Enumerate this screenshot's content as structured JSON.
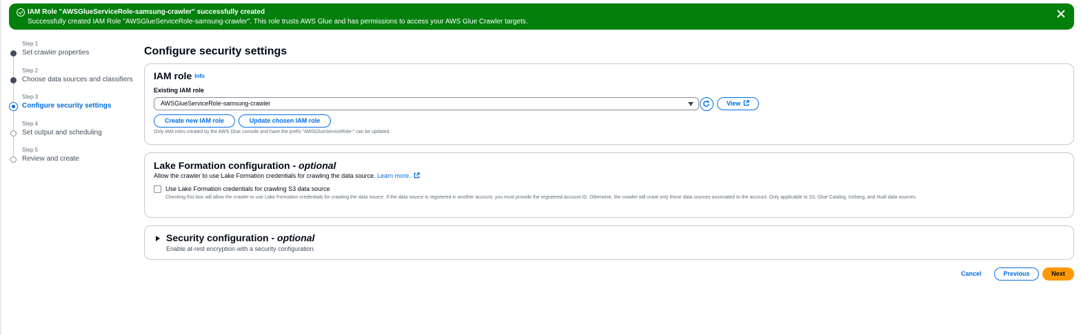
{
  "flash": {
    "title": "IAM Role \"AWSGlueServiceRole-samsung-crawler\" successfully created",
    "message": "Successfully created IAM Role \"AWSGlueServiceRole-samsung-crawler\". This role trusts AWS Glue and has permissions to access your AWS Glue Crawler targets.",
    "color": "#037f0c"
  },
  "steps": [
    {
      "num": "Step 1",
      "label": "Set crawler properties",
      "state": "done"
    },
    {
      "num": "Step 2",
      "label": "Choose data sources and classifiers",
      "state": "done"
    },
    {
      "num": "Step 3",
      "label": "Configure security settings",
      "state": "active"
    },
    {
      "num": "Step 4",
      "label": "Set output and scheduling",
      "state": "pending"
    },
    {
      "num": "Step 5",
      "label": "Review and create",
      "state": "pending"
    }
  ],
  "page_title": "Configure security settings",
  "iam": {
    "heading": "IAM role",
    "info": "Info",
    "field_label": "Existing IAM role",
    "selected": "AWSGlueServiceRole-samsung-crawler",
    "view_label": "View",
    "create_label": "Create new IAM role",
    "update_label": "Update chosen IAM role",
    "hint": "Only IAM roles created by the AWS Glue console and have the prefix \"AWSGlueServiceRole-\" can be updated."
  },
  "lake_formation": {
    "heading": "Lake Formation configuration - ",
    "heading_optional": "optional",
    "desc": "Allow the crawler to use Lake Formation credentials for crawling the data source. ",
    "learn_more": "Learn more.",
    "checkbox_label": "Use Lake Formation credentials for crawling S3 data source",
    "checkbox_desc": "Checking this box will allow the crawler to use Lake Formation credentials for crawling the data source. If the data source is registered in another account, you must provide the registered account ID. Otherwise, the crawler will crawl only those data sources associated to the account. Only applicable to S3, Glue Catalog, Iceberg, and Hudi data sources.",
    "checked": false
  },
  "security_config": {
    "heading": "Security configuration - ",
    "heading_optional": "optional",
    "desc": "Enable at-rest encryption with a security configuration."
  },
  "footer": {
    "cancel": "Cancel",
    "previous": "Previous",
    "next": "Next"
  },
  "colors": {
    "accent": "#006ce0",
    "primary_button": "#ff9900",
    "success": "#037f0c"
  }
}
